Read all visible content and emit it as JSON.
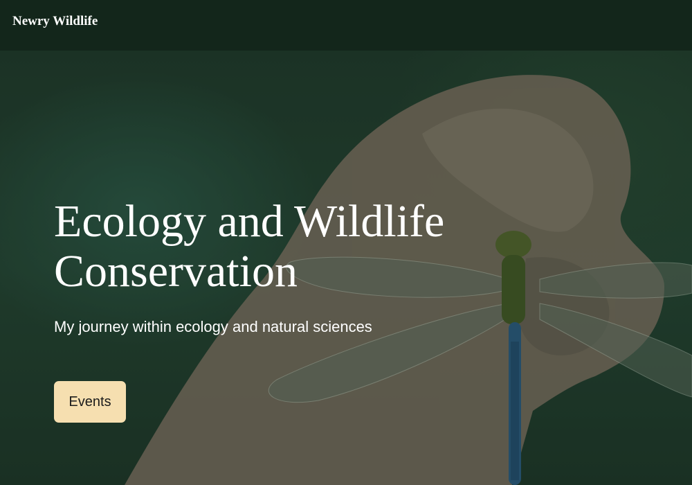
{
  "nav": {
    "brand": "Newry Wildlife"
  },
  "hero": {
    "title_line_1": "Ecology and Wildlife",
    "title_line_2": "Conservation",
    "subtitle": "My journey within ecology and natural sciences",
    "button_label": "Events",
    "image_subject": "hand-holding-dragonfly-photo"
  },
  "colors": {
    "nav_background": "#13261b",
    "overlay": "#1e3a2a",
    "button_background": "#f6dfb0",
    "text": "#ffffff"
  }
}
